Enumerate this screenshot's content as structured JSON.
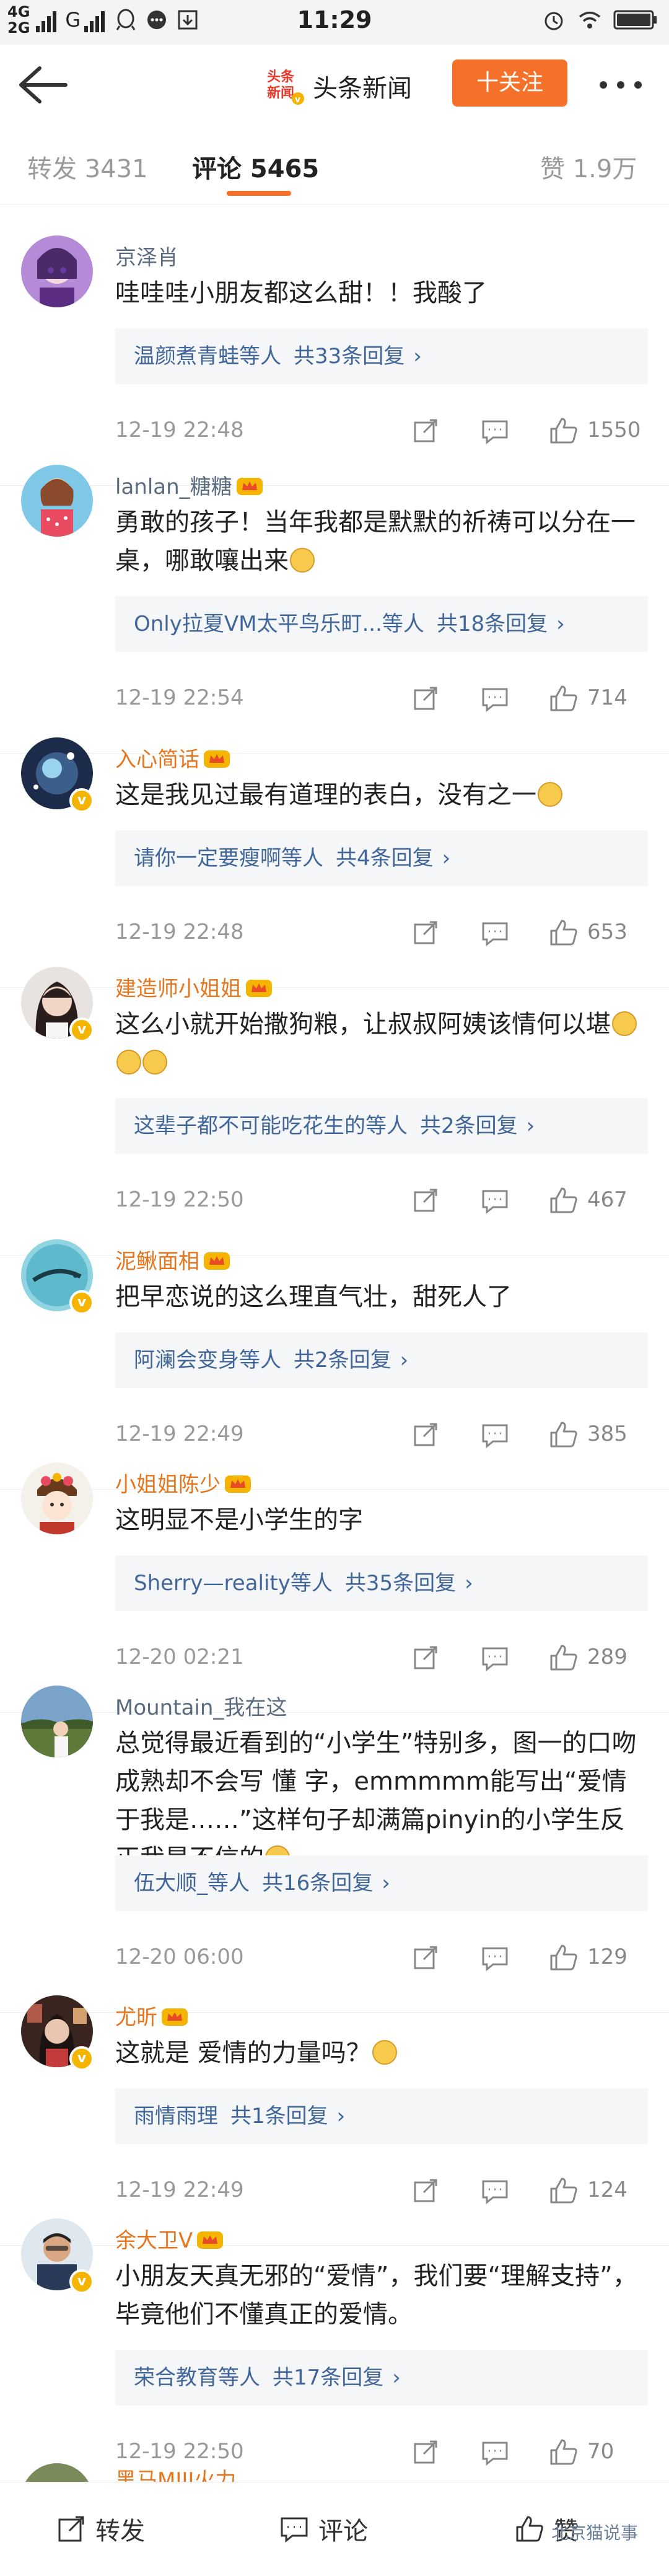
{
  "status_bar": {
    "net_top": "4G",
    "net_bottom": "2G",
    "carrier_g": "G",
    "time": "11:29"
  },
  "nav": {
    "logo_text": "头条新闻",
    "account_name": "头条新闻",
    "follow_label": "十关注"
  },
  "tabs": {
    "repost_label": "转发 3431",
    "comment_label": "评论 5465",
    "like_label": "赞 1.9万"
  },
  "comments": [
    {
      "user": "京泽肖",
      "text": "哇哇哇小朋友都这么甜！！我酸了",
      "reply_names": "温颜煮青蛙等人",
      "reply_count": "共33条回复",
      "time": "12-19 22:48",
      "likes": "1550"
    },
    {
      "user": "lanlan_糖糖",
      "text": "勇敢的孩子！当年我都是默默的祈祷可以分在一桌，哪敢嚷出来",
      "reply_names": "Only拉夏VM太平鸟乐町...等人",
      "reply_count": "共18条回复",
      "time": "12-19 22:54",
      "likes": "714"
    },
    {
      "user": "入心简话",
      "text": "这是我见过最有道理的表白，没有之一",
      "reply_names": "请你一定要瘦啊等人",
      "reply_count": "共4条回复",
      "time": "12-19 22:48",
      "likes": "653"
    },
    {
      "user": "建造师小姐姐",
      "text": "这么小就开始撒狗粮，让叔叔阿姨该情何以堪",
      "reply_names": "这辈子都不可能吃花生的等人",
      "reply_count": "共2条回复",
      "time": "12-19 22:50",
      "likes": "467"
    },
    {
      "user": "泥鳅面相",
      "text": "把早恋说的这么理直气壮，甜死人了",
      "reply_names": "阿澜会变身等人",
      "reply_count": "共2条回复",
      "time": "12-19 22:49",
      "likes": "385"
    },
    {
      "user": "小姐姐陈少",
      "text": "这明显不是小学生的字",
      "reply_names": "Sherry—reality等人",
      "reply_count": "共35条回复",
      "time": "12-20 02:21",
      "likes": "289"
    },
    {
      "user": "Mountain_我在这",
      "text": "总觉得最近看到的“小学生”特别多，图一的口吻成熟却不会写 懂 字，emmmmm能写出“爱情于我是……”这样句子却满篇pinyin的小学生反正我是不信的",
      "reply_names": "伍大顺_等人",
      "reply_count": "共16条回复",
      "time": "12-20 06:00",
      "likes": "129"
    },
    {
      "user": "尤昕",
      "text": "这就是 爱情的力量吗？",
      "reply_names": "雨情雨理",
      "reply_count": "共1条回复",
      "time": "12-19 22:49",
      "likes": "124"
    },
    {
      "user": "余大卫V",
      "text": "小朋友天真无邪的“爱情”，我们要“理解支持”，毕竟他们不懂真正的爱情。",
      "reply_names": "荣合教育等人",
      "reply_count": "共17条回复",
      "time": "12-19 22:50",
      "likes": "70"
    }
  ],
  "partial_user": "黑马MIII火力",
  "bottom": {
    "repost_label": "转发",
    "comment_label": "评论",
    "like_label": "赞",
    "watermark": "北京猫说事"
  },
  "colors": {
    "accent": "#f5712a",
    "username_normal": "#5b6b80",
    "username_vip": "#e5761e",
    "reply_link": "#406599",
    "reply_bg": "#f5f6f8"
  }
}
